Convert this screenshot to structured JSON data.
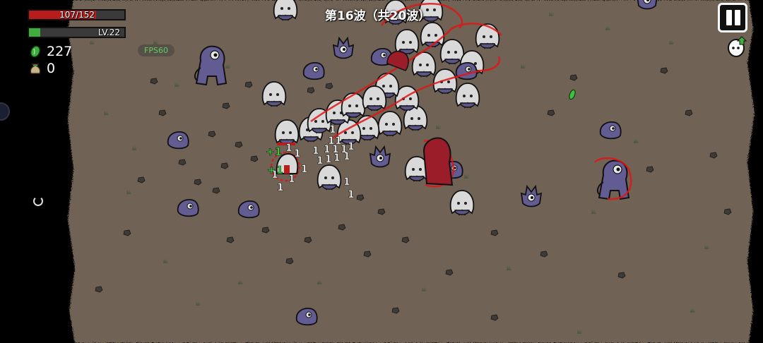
{
  "hud": {
    "hp": {
      "current": 107,
      "max": 152,
      "text": "107/152",
      "color": "#b81d1d"
    },
    "level": {
      "text": "LV.22",
      "progress": 0.12,
      "color": "#3fae3f"
    },
    "seeds": {
      "count": "227",
      "icon": "green-seed-icon"
    },
    "bag": {
      "count": "0",
      "icon": "money-bag-icon"
    },
    "fps": "FPS60",
    "wave": "第16波（共20波）",
    "pause_icon": "pause-icon",
    "pet_icon": "egg-pet-icon"
  },
  "arena": {
    "ground_color": "#6f6255",
    "enemy_color": "#635c93",
    "hit_glow_color": "#e01515",
    "player_heal_text": "+1",
    "damage_number": "1"
  }
}
